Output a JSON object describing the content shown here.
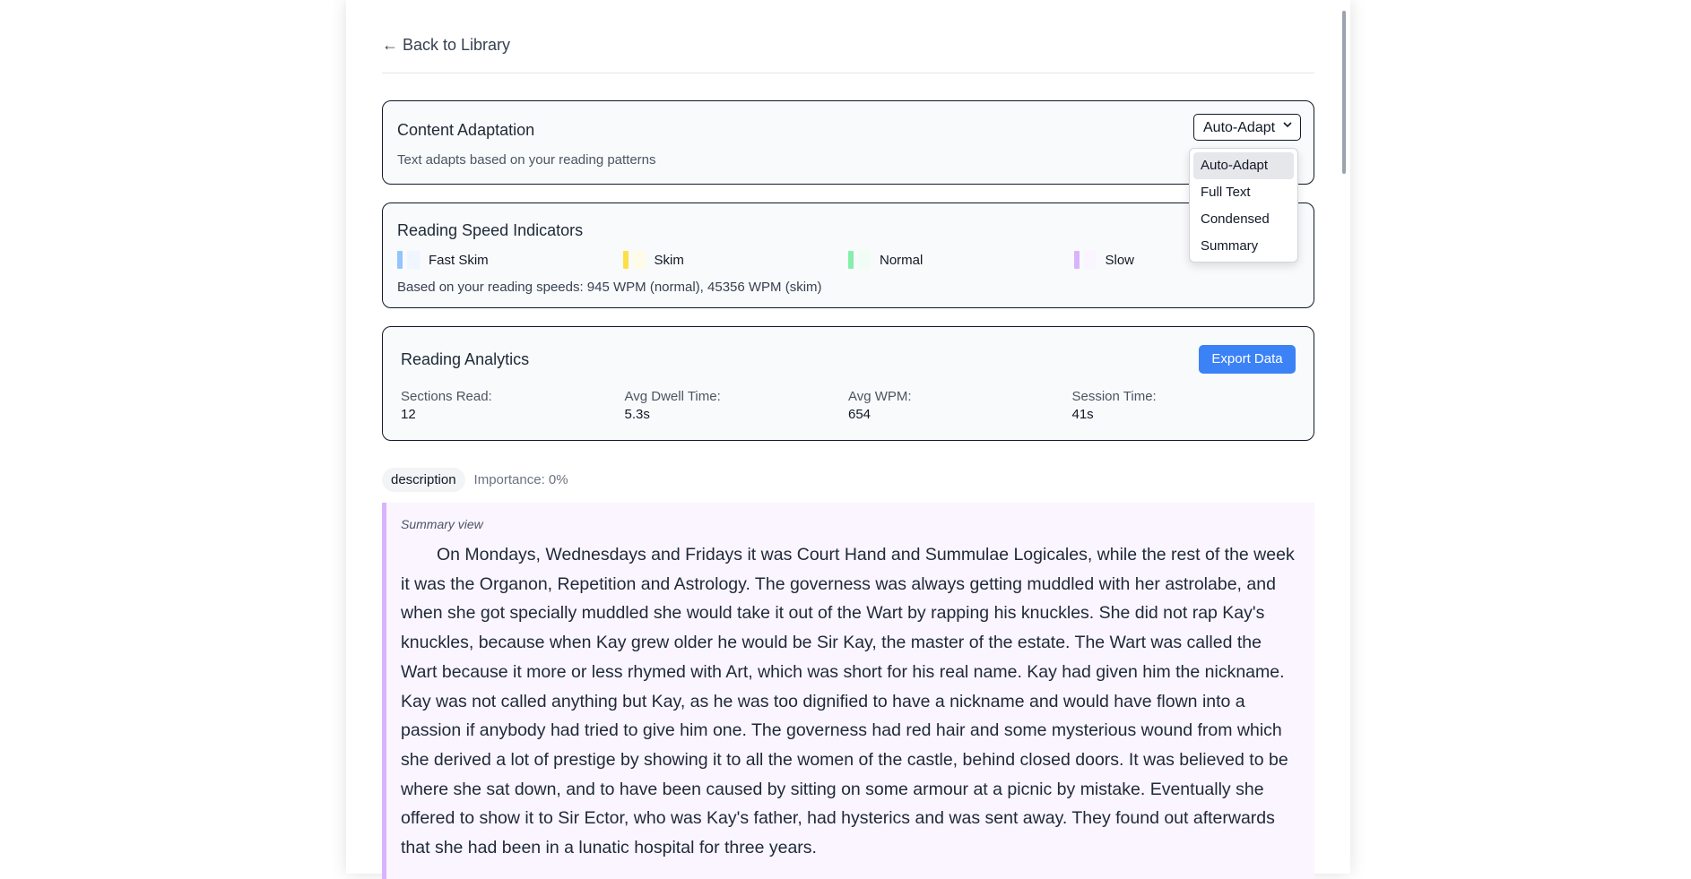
{
  "nav": {
    "back_label": "← Back to Library"
  },
  "adaptation": {
    "title": "Content Adaptation",
    "subtitle": "Text adapts based on your reading patterns",
    "selected": "Auto-Adapt",
    "options": [
      "Auto-Adapt",
      "Full Text",
      "Condensed",
      "Summary"
    ]
  },
  "speed": {
    "title": "Reading Speed Indicators",
    "legend": [
      {
        "label": "Fast Skim",
        "color": "#93c5fd",
        "tint": "#eff6ff"
      },
      {
        "label": "Skim",
        "color": "#fde047",
        "tint": "#fefce8"
      },
      {
        "label": "Normal",
        "color": "#86efac",
        "tint": "#f0fdf4"
      },
      {
        "label": "Slow",
        "color": "#d8b4fe",
        "tint": "#faf5ff"
      }
    ],
    "note": "Based on your reading speeds: 945 WPM (normal), 45356 WPM (skim)"
  },
  "analytics": {
    "title": "Reading Analytics",
    "export_label": "Export Data",
    "stats": [
      {
        "label": "Sections Read:",
        "value": "12"
      },
      {
        "label": "Avg Dwell Time:",
        "value": "5.3s"
      },
      {
        "label": "Avg WPM:",
        "value": "654"
      },
      {
        "label": "Session Time:",
        "value": "41s"
      }
    ]
  },
  "section": {
    "tag": "description",
    "importance": "Importance: 0%",
    "view_label": "Summary view",
    "text": "On Mondays, Wednesdays and Fridays it was Court Hand and Summulae Logicales, while the rest of the week it was the Organon, Repetition and Astrology. The governess was always getting muddled with her astrolabe, and when she got specially muddled she would take it out of the Wart by rapping his knuckles. She did not rap Kay's knuckles, because when Kay grew older he would be Sir Kay, the master of the estate. The Wart was called the Wart because it more or less rhymed with Art, which was short for his real name. Kay had given him the nickname. Kay was not called anything but Kay, as he was too dignified to have a nickname and would have flown into a passion if anybody had tried to give him one. The governess had red hair and some mysterious wound from which she derived a lot of prestige by showing it to all the women of the castle, behind closed doors. It was believed to be where she sat down, and to have been caused by sitting on some armour at a picnic by mistake. Eventually she offered to show it to Sir Ector, who was Kay's father, had hysterics and was sent away. They found out afterwards that she had been in a lunatic hospital for three years."
  },
  "icons": {
    "dropdown": "chevron-down-icon"
  }
}
